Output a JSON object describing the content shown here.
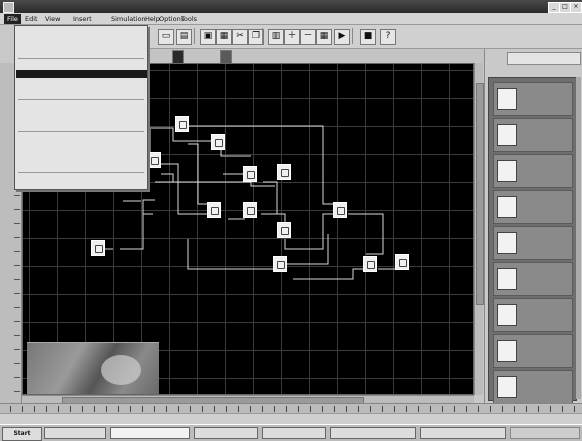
{
  "window": {
    "title": ""
  },
  "menubar": {
    "items": [
      "File",
      "Edit",
      "View",
      "Insert",
      "Simulation",
      "Help",
      "Options",
      "Tools"
    ],
    "open_index": 0
  },
  "file_menu": {
    "items": [
      {
        "label": "",
        "shortcut": ""
      },
      {
        "label": "",
        "shortcut": ""
      },
      {
        "label": "",
        "shortcut": ""
      },
      {
        "sep": true
      },
      {
        "label": "",
        "shortcut": ""
      },
      {
        "label": "",
        "shortcut": "",
        "highlight": true
      },
      {
        "label": "",
        "shortcut": ""
      },
      {
        "label": "",
        "shortcut": ""
      },
      {
        "sep": true
      },
      {
        "label": "",
        "shortcut": ""
      },
      {
        "label": "",
        "shortcut": ""
      },
      {
        "label": "",
        "shortcut": ""
      },
      {
        "sep": true
      },
      {
        "label": "",
        "shortcut": ""
      },
      {
        "label": "",
        "shortcut": ""
      },
      {
        "label": "",
        "shortcut": ""
      },
      {
        "label": "",
        "shortcut": ""
      },
      {
        "sep": true
      },
      {
        "label": "",
        "shortcut": ""
      }
    ]
  },
  "tabs": [
    "",
    "",
    ""
  ],
  "right_panel": {
    "header": "",
    "items": [
      "",
      "",
      "",
      "",
      "",
      "",
      "",
      "",
      ""
    ]
  },
  "status": {
    "left": "",
    "right": ""
  },
  "taskbar": {
    "start": "Start",
    "tasks": [
      "",
      "",
      "",
      "",
      "",
      ""
    ],
    "clock": ""
  },
  "icons": {
    "toolbar": [
      "new-icon",
      "open-icon",
      "save-icon",
      "print-icon",
      "cut-icon",
      "copy-icon",
      "paste-icon",
      "zoom-in-icon",
      "zoom-out-icon",
      "grid-icon",
      "run-icon",
      "stop-icon",
      "help-icon"
    ]
  }
}
